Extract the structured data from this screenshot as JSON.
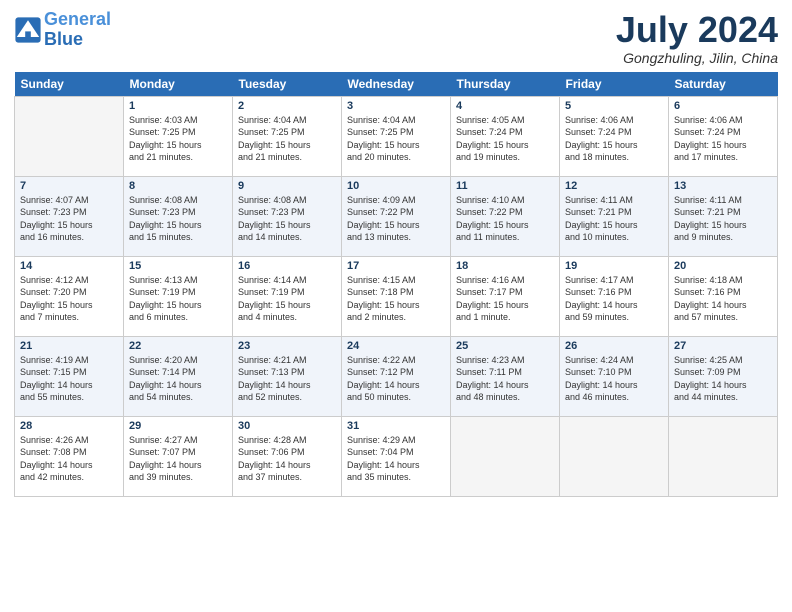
{
  "header": {
    "logo_line1": "General",
    "logo_line2": "Blue",
    "month": "July 2024",
    "location": "Gongzhuling, Jilin, China"
  },
  "days_of_week": [
    "Sunday",
    "Monday",
    "Tuesday",
    "Wednesday",
    "Thursday",
    "Friday",
    "Saturday"
  ],
  "weeks": [
    [
      {
        "day": "",
        "info": ""
      },
      {
        "day": "1",
        "info": "Sunrise: 4:03 AM\nSunset: 7:25 PM\nDaylight: 15 hours\nand 21 minutes."
      },
      {
        "day": "2",
        "info": "Sunrise: 4:04 AM\nSunset: 7:25 PM\nDaylight: 15 hours\nand 21 minutes."
      },
      {
        "day": "3",
        "info": "Sunrise: 4:04 AM\nSunset: 7:25 PM\nDaylight: 15 hours\nand 20 minutes."
      },
      {
        "day": "4",
        "info": "Sunrise: 4:05 AM\nSunset: 7:24 PM\nDaylight: 15 hours\nand 19 minutes."
      },
      {
        "day": "5",
        "info": "Sunrise: 4:06 AM\nSunset: 7:24 PM\nDaylight: 15 hours\nand 18 minutes."
      },
      {
        "day": "6",
        "info": "Sunrise: 4:06 AM\nSunset: 7:24 PM\nDaylight: 15 hours\nand 17 minutes."
      }
    ],
    [
      {
        "day": "7",
        "info": "Sunrise: 4:07 AM\nSunset: 7:23 PM\nDaylight: 15 hours\nand 16 minutes."
      },
      {
        "day": "8",
        "info": "Sunrise: 4:08 AM\nSunset: 7:23 PM\nDaylight: 15 hours\nand 15 minutes."
      },
      {
        "day": "9",
        "info": "Sunrise: 4:08 AM\nSunset: 7:23 PM\nDaylight: 15 hours\nand 14 minutes."
      },
      {
        "day": "10",
        "info": "Sunrise: 4:09 AM\nSunset: 7:22 PM\nDaylight: 15 hours\nand 13 minutes."
      },
      {
        "day": "11",
        "info": "Sunrise: 4:10 AM\nSunset: 7:22 PM\nDaylight: 15 hours\nand 11 minutes."
      },
      {
        "day": "12",
        "info": "Sunrise: 4:11 AM\nSunset: 7:21 PM\nDaylight: 15 hours\nand 10 minutes."
      },
      {
        "day": "13",
        "info": "Sunrise: 4:11 AM\nSunset: 7:21 PM\nDaylight: 15 hours\nand 9 minutes."
      }
    ],
    [
      {
        "day": "14",
        "info": "Sunrise: 4:12 AM\nSunset: 7:20 PM\nDaylight: 15 hours\nand 7 minutes."
      },
      {
        "day": "15",
        "info": "Sunrise: 4:13 AM\nSunset: 7:19 PM\nDaylight: 15 hours\nand 6 minutes."
      },
      {
        "day": "16",
        "info": "Sunrise: 4:14 AM\nSunset: 7:19 PM\nDaylight: 15 hours\nand 4 minutes."
      },
      {
        "day": "17",
        "info": "Sunrise: 4:15 AM\nSunset: 7:18 PM\nDaylight: 15 hours\nand 2 minutes."
      },
      {
        "day": "18",
        "info": "Sunrise: 4:16 AM\nSunset: 7:17 PM\nDaylight: 15 hours\nand 1 minute."
      },
      {
        "day": "19",
        "info": "Sunrise: 4:17 AM\nSunset: 7:16 PM\nDaylight: 14 hours\nand 59 minutes."
      },
      {
        "day": "20",
        "info": "Sunrise: 4:18 AM\nSunset: 7:16 PM\nDaylight: 14 hours\nand 57 minutes."
      }
    ],
    [
      {
        "day": "21",
        "info": "Sunrise: 4:19 AM\nSunset: 7:15 PM\nDaylight: 14 hours\nand 55 minutes."
      },
      {
        "day": "22",
        "info": "Sunrise: 4:20 AM\nSunset: 7:14 PM\nDaylight: 14 hours\nand 54 minutes."
      },
      {
        "day": "23",
        "info": "Sunrise: 4:21 AM\nSunset: 7:13 PM\nDaylight: 14 hours\nand 52 minutes."
      },
      {
        "day": "24",
        "info": "Sunrise: 4:22 AM\nSunset: 7:12 PM\nDaylight: 14 hours\nand 50 minutes."
      },
      {
        "day": "25",
        "info": "Sunrise: 4:23 AM\nSunset: 7:11 PM\nDaylight: 14 hours\nand 48 minutes."
      },
      {
        "day": "26",
        "info": "Sunrise: 4:24 AM\nSunset: 7:10 PM\nDaylight: 14 hours\nand 46 minutes."
      },
      {
        "day": "27",
        "info": "Sunrise: 4:25 AM\nSunset: 7:09 PM\nDaylight: 14 hours\nand 44 minutes."
      }
    ],
    [
      {
        "day": "28",
        "info": "Sunrise: 4:26 AM\nSunset: 7:08 PM\nDaylight: 14 hours\nand 42 minutes."
      },
      {
        "day": "29",
        "info": "Sunrise: 4:27 AM\nSunset: 7:07 PM\nDaylight: 14 hours\nand 39 minutes."
      },
      {
        "day": "30",
        "info": "Sunrise: 4:28 AM\nSunset: 7:06 PM\nDaylight: 14 hours\nand 37 minutes."
      },
      {
        "day": "31",
        "info": "Sunrise: 4:29 AM\nSunset: 7:04 PM\nDaylight: 14 hours\nand 35 minutes."
      },
      {
        "day": "",
        "info": ""
      },
      {
        "day": "",
        "info": ""
      },
      {
        "day": "",
        "info": ""
      }
    ]
  ]
}
